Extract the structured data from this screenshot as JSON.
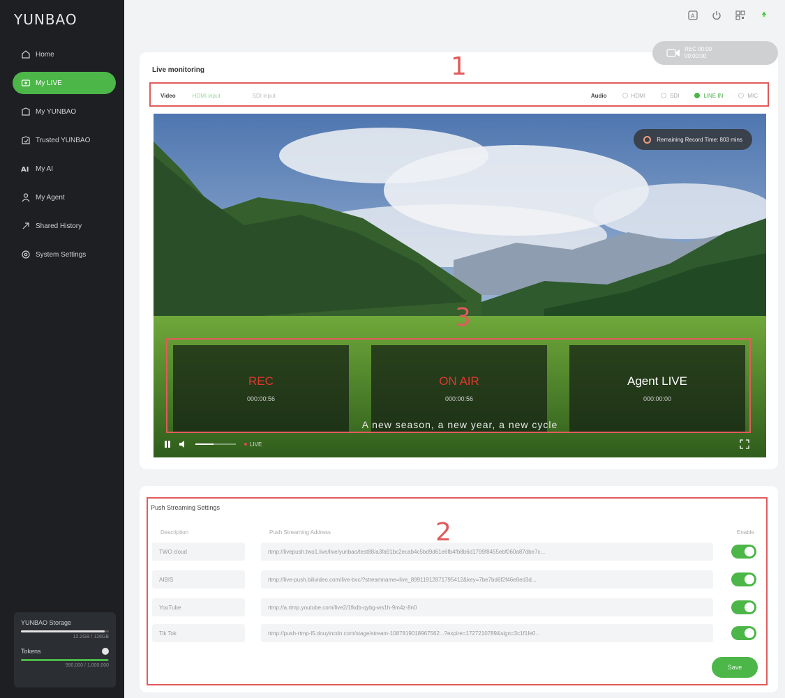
{
  "app": {
    "logo": "YUNBAO"
  },
  "sidebar": {
    "items": [
      {
        "label": "Home",
        "icon": "home-icon",
        "active": false
      },
      {
        "label": "My LIVE",
        "icon": "live-icon",
        "active": true
      },
      {
        "label": "My YUNBAO",
        "icon": "yunbao-icon",
        "active": false
      },
      {
        "label": "Trusted YUNBAO",
        "icon": "trusted-icon",
        "active": false
      },
      {
        "label": "My AI",
        "icon": "ai-icon",
        "active": false
      },
      {
        "label": "My Agent",
        "icon": "agent-icon",
        "active": false
      },
      {
        "label": "Shared History",
        "icon": "share-icon",
        "active": false
      },
      {
        "label": "System Settings",
        "icon": "settings-icon",
        "active": false
      }
    ],
    "storage": {
      "title": "YUNBAO Storage",
      "detail": "12.2GB / 128GB",
      "fill_fraction": 0.95
    },
    "tokens": {
      "title": "Tokens",
      "detail": "990,000 / 1,000,000",
      "fill_fraction": 0.99
    }
  },
  "header": {
    "icons": [
      "translate-icon",
      "power-icon",
      "qr-icon",
      "notification-icon"
    ]
  },
  "live": {
    "title": "Live monitoring",
    "record_pill": {
      "line1": "REC 00:00",
      "line2": "00:00:00"
    },
    "sources": {
      "video_label": "Video",
      "video_options": [
        "HDMI input",
        "SDI input"
      ],
      "audio_label": "Audio",
      "audio_options": [
        {
          "label": "HDMI",
          "selected": false
        },
        {
          "label": "SDI",
          "selected": false
        },
        {
          "label": "LINE IN",
          "selected": true
        },
        {
          "label": "MIC",
          "selected": false
        }
      ]
    },
    "remaining_text": "Remaining Record Time: 803 mins",
    "status": [
      {
        "label": "REC",
        "time": "000:00:56",
        "color": "#e0382e"
      },
      {
        "label": "ON AIR",
        "time": "000:00:56",
        "color": "#e0382e"
      },
      {
        "label": "Agent LIVE",
        "time": "000:00:00",
        "color": "#ffffff"
      }
    ],
    "subtitle": "A new season, a new year, a new cycle",
    "live_badge": "LIVE",
    "volume_fraction": 0.45
  },
  "push": {
    "title": "Push Streaming Settings",
    "columns": {
      "description": "Description",
      "address": "Push Streaming Address",
      "enable": "Enable"
    },
    "rows": [
      {
        "description": "TWO cloud",
        "address": "rtmp://livepush.two1.live/live/yunbao/test88/a3fa91bc2ecab4c5bd9d61e6fb4fb8b6d1799f8455ebf060a87dbe7c...",
        "enabled": true
      },
      {
        "description": "AIBIS",
        "address": "rtmp://live-push.bilivideo.com/live-bvc/?streamname=live_89911912871795412&key=7be7bd6f2f46e8ed3d...",
        "enabled": true
      },
      {
        "description": "YouTube",
        "address": "rtmp://a.rtmp.youtube.com/live2/1fkdb-qybg-ws1h-9m4z-8n0",
        "enabled": true
      },
      {
        "description": "Tik Tok",
        "address": "rtmp://push-rtmp-l5.douyincdn.com/stage/stream-1087819018967562...?expire=1727210789&sign=3c1f1fe0...",
        "enabled": true
      }
    ],
    "save_label": "Save"
  },
  "annotations": [
    "1",
    "2",
    "3"
  ],
  "colors": {
    "accent": "#4cb648",
    "annotation": "#e15b5b",
    "sidebar": "#1d1f22"
  }
}
